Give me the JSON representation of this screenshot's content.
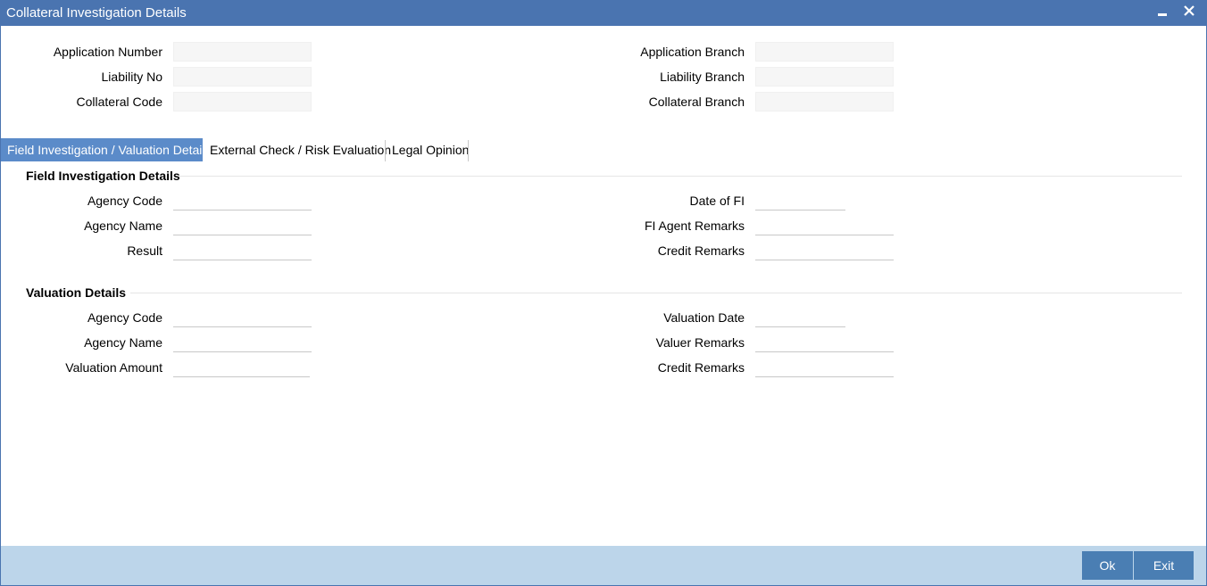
{
  "window": {
    "title": "Collateral Investigation Details"
  },
  "header_fields": [
    {
      "label": "Application Number",
      "value": ""
    },
    {
      "label": "Liability No",
      "value": ""
    },
    {
      "label": "Collateral Code",
      "value": ""
    },
    {
      "label": "Application Branch",
      "value": ""
    },
    {
      "label": "Liability Branch",
      "value": ""
    },
    {
      "label": "Collateral Branch",
      "value": ""
    }
  ],
  "tabs": [
    {
      "label": "Field Investigation / Valuation Details",
      "active": true
    },
    {
      "label": "External Check / Risk Evaluation",
      "active": false
    },
    {
      "label": "Legal Opinion",
      "active": false
    }
  ],
  "field_investigation": {
    "title": "Field Investigation Details",
    "fields": [
      {
        "label": "Agency Code",
        "value": ""
      },
      {
        "label": "Agency Name",
        "value": ""
      },
      {
        "label": "Result",
        "value": ""
      },
      {
        "label": "Date of FI",
        "value": ""
      },
      {
        "label": "FI Agent Remarks",
        "value": ""
      },
      {
        "label": "Credit Remarks",
        "value": ""
      }
    ]
  },
  "valuation": {
    "title": "Valuation Details",
    "fields": [
      {
        "label": "Agency Code",
        "value": ""
      },
      {
        "label": "Agency Name",
        "value": ""
      },
      {
        "label": "Valuation Amount",
        "value": ""
      },
      {
        "label": "Valuation Date",
        "value": ""
      },
      {
        "label": "Valuer Remarks",
        "value": ""
      },
      {
        "label": "Credit Remarks",
        "value": ""
      }
    ]
  },
  "footer": {
    "ok_label": "Ok",
    "exit_label": "Exit"
  },
  "colors": {
    "titlebar": "#4a74b0",
    "active_tab": "#5b8bc9",
    "footer": "#bcd5ea",
    "button": "#4a7eb3"
  }
}
